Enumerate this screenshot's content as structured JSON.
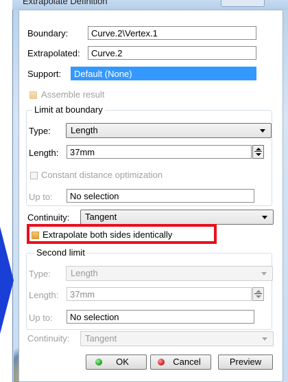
{
  "window": {
    "title": "Extrapolate Definition"
  },
  "boundary": {
    "label": "Boundary:",
    "value": "Curve.2\\Vertex.1"
  },
  "extrapolated": {
    "label": "Extrapolated:",
    "value": "Curve.2"
  },
  "support": {
    "label": "Support:",
    "value": "Default (None)"
  },
  "assemble_result": {
    "label": "Assemble result"
  },
  "limit_group": {
    "title": "Limit at boundary",
    "type_label": "Type:",
    "type_value": "Length",
    "length_label": "Length:",
    "length_value": "37mm",
    "const_dist_label": "Constant distance optimization",
    "upto_label": "Up to:",
    "upto_value": "No selection"
  },
  "continuity": {
    "label": "Continuity:",
    "value": "Tangent"
  },
  "extrapolate_both": {
    "label": "Extrapolate both sides identically"
  },
  "second_group": {
    "title": "Second limit",
    "type_label": "Type:",
    "type_value": "Length",
    "length_label": "Length:",
    "length_value": "37mm",
    "upto_label": "Up to:",
    "upto_value": "No selection",
    "continuity_label": "Continuity:",
    "continuity_value": "Tangent"
  },
  "buttons": {
    "ok": "OK",
    "cancel": "Cancel",
    "preview": "Preview"
  },
  "colors": {
    "highlight": "#e8101c",
    "selection": "#3399ff",
    "arrow": "#1a3fd6"
  }
}
